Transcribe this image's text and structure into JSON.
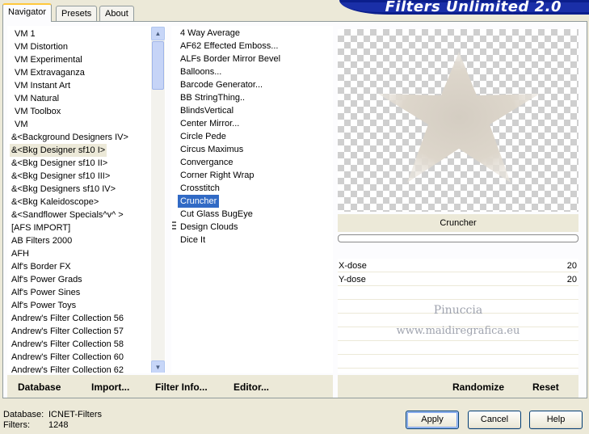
{
  "tabs": [
    "Navigator",
    "Presets",
    "About"
  ],
  "banner_title": "Filters Unlimited 2.0",
  "categories": [
    "VM 1",
    "VM Distortion",
    "VM Experimental",
    "VM Extravaganza",
    "VM Instant Art",
    "VM Natural",
    "VM Toolbox",
    "VM",
    "&<Background Designers IV>",
    "&<Bkg Designer sf10 I>",
    "&<Bkg Designer sf10 II>",
    "&<Bkg Designer sf10 III>",
    "&<Bkg Designers sf10 IV>",
    "&<Bkg Kaleidoscope>",
    "&<Sandflower Specials^v^ >",
    "[AFS IMPORT]",
    "AB Filters 2000",
    "AFH",
    "Alf's Border FX",
    "Alf's Power Grads",
    "Alf's Power Sines",
    "Alf's Power Toys",
    "Andrew's Filter Collection 56",
    "Andrew's Filter Collection 57",
    "Andrew's Filter Collection 58",
    "Andrew's Filter Collection 60",
    "Andrew's Filter Collection 62"
  ],
  "selected_category": "&<Bkg Designer sf10 I>",
  "filters": [
    "4 Way Average",
    "AF62 Effected Emboss...",
    "ALFs Border Mirror Bevel",
    "Balloons...",
    "Barcode Generator...",
    "BB StringThing..",
    "BlindsVertical",
    "Center Mirror...",
    "Circle Pede",
    "Circus Maximus",
    "Convergance",
    "Corner Right Wrap",
    "Crosstitch",
    "Cruncher",
    "Cut Glass  BugEye",
    "Design Clouds",
    "Dice It"
  ],
  "selected_filter": "Cruncher",
  "preview_filter_name": "Cruncher",
  "progress": 0,
  "params": [
    {
      "label": "X-dose",
      "value": "20"
    },
    {
      "label": "Y-dose",
      "value": "20"
    }
  ],
  "watermark": {
    "line1": "Pinuccia",
    "line2": "www.maidiregrafica.eu"
  },
  "links": {
    "database": "Database",
    "import": "Import...",
    "filter_info": "Filter Info...",
    "editor": "Editor...",
    "randomize": "Randomize",
    "reset": "Reset"
  },
  "status": {
    "database_label": "Database:",
    "database_value": "ICNET-Filters",
    "filters_label": "Filters:",
    "filters_value": "1248"
  },
  "buttons": {
    "apply": "Apply",
    "cancel": "Cancel",
    "help": "Help"
  },
  "colors": {
    "selection": "#316ac5",
    "window_bg": "#ece9d8",
    "banner": "#0b1e8c"
  }
}
